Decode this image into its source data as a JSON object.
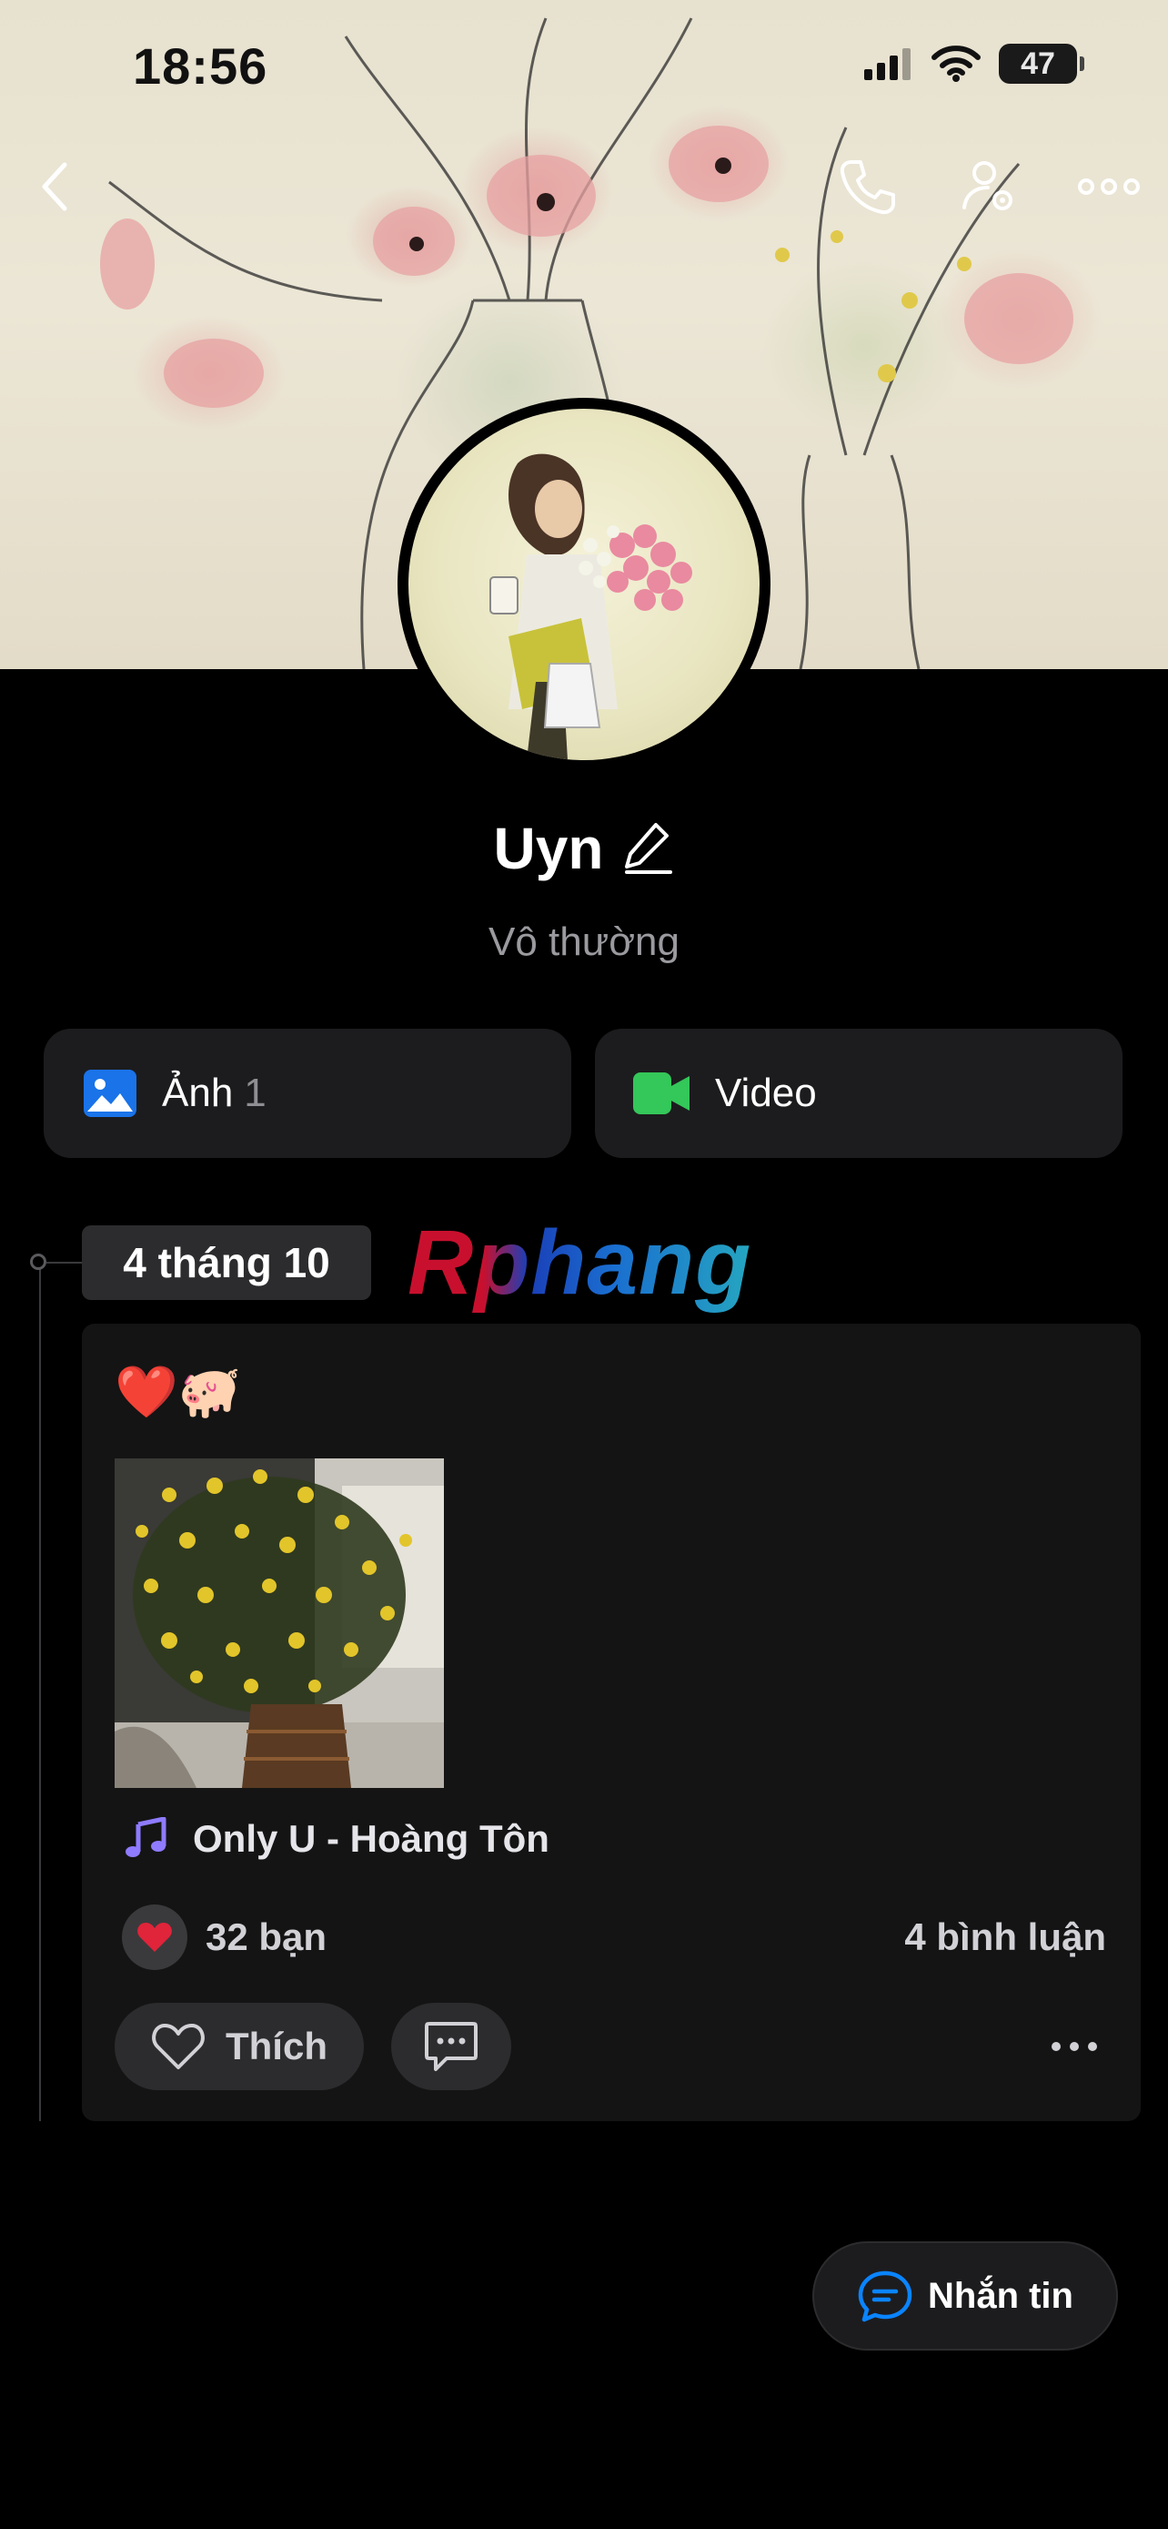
{
  "status_bar": {
    "time": "18:56",
    "battery": "47"
  },
  "profile": {
    "name": "Uyn",
    "bio": "Vô thường"
  },
  "media_buttons": [
    {
      "label": "Ảnh",
      "count": "1",
      "icon": "photo-icon",
      "color": "#1a73e8"
    },
    {
      "label": "Video",
      "count": "",
      "icon": "video-icon",
      "color": "#34c759"
    }
  ],
  "timeline": {
    "date": "4 tháng 10",
    "watermark": "Rphang"
  },
  "post": {
    "caption": "❤️🐖",
    "music": "Only U - Hoàng Tôn",
    "likes": "32 bạn",
    "comments": "4 bình luận",
    "like_label": "Thích"
  },
  "message_button": {
    "label": "Nhắn tin"
  },
  "colors": {
    "background": "#000000",
    "card": "#141414",
    "button": "#1c1c1e",
    "accent_blue": "#0a84ff",
    "heart_red": "#e0243a"
  }
}
